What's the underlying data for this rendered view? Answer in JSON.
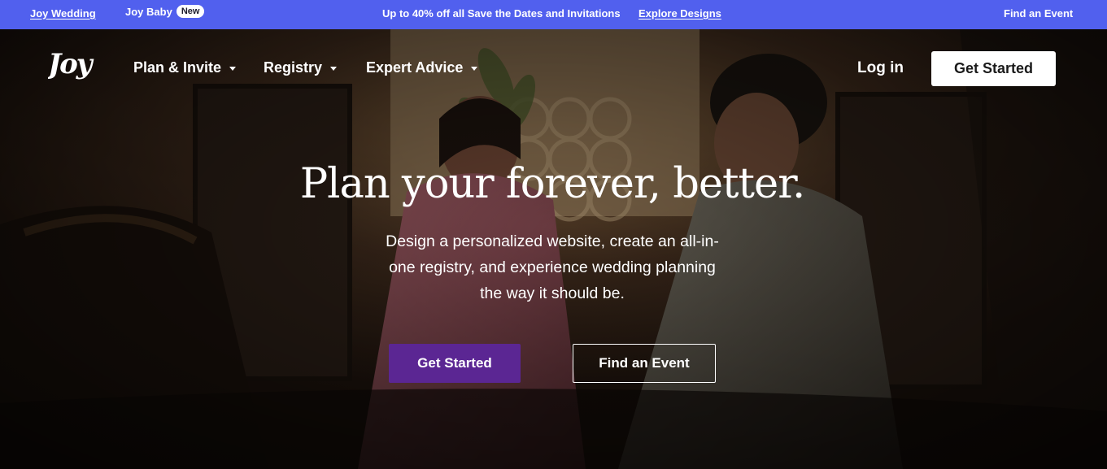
{
  "promo_bar": {
    "joy_wedding": "Joy Wedding",
    "joy_baby": "Joy Baby",
    "new_badge": "New",
    "offer_text": "Up to 40% off all Save the Dates and Invitations",
    "explore_link": "Explore Designs",
    "find_event": "Find an Event",
    "background_color": "#5160ee"
  },
  "nav": {
    "logo_text": "Joy",
    "items": [
      {
        "label": "Plan & Invite",
        "icon": "chevron-down-icon"
      },
      {
        "label": "Registry",
        "icon": "chevron-down-icon"
      },
      {
        "label": "Expert Advice",
        "icon": "chevron-down-icon"
      }
    ],
    "login": "Log in",
    "get_started": "Get Started"
  },
  "hero": {
    "headline": "Plan your forever, better.",
    "subtitle": "Design a personalized website, create an all-in-one registry, and experience wedding planning the way it should be.",
    "primary_button": "Get Started",
    "secondary_button": "Find an Event",
    "accent_color": "#5b2693"
  }
}
